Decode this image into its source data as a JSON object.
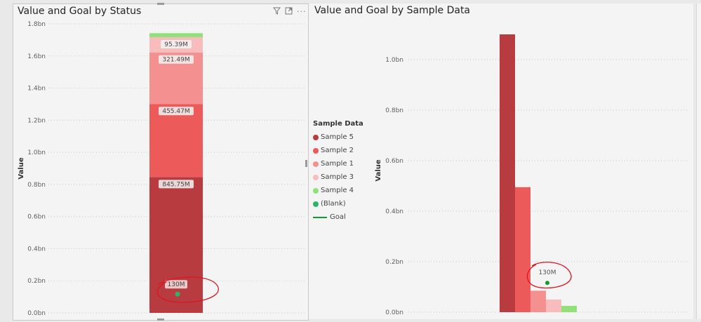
{
  "chart_data": [
    {
      "type": "bar",
      "stacked": true,
      "title": "Value and Goal by Status",
      "ylabel": "Value",
      "ylim": [
        0,
        1.8
      ],
      "yticks": [
        "0.0bn",
        "0.2bn",
        "0.4bn",
        "0.6bn",
        "0.8bn",
        "1.0bn",
        "1.2bn",
        "1.4bn",
        "1.6bn",
        "1.8bn"
      ],
      "grid": true,
      "segments": [
        {
          "name": "Sample 5",
          "value": 0.846,
          "label": "845.75M",
          "color": "#b83c3f"
        },
        {
          "name": "Sample 2",
          "value": 0.455,
          "label": "455.47M",
          "color": "#ec5a5a"
        },
        {
          "name": "Sample 1",
          "value": 0.321,
          "label": "321.49M",
          "color": "#f49090"
        },
        {
          "name": "Sample 3",
          "value": 0.095,
          "label": "95.39M",
          "color": "#f8bcbc"
        },
        {
          "name": "Sample 4",
          "value": 0.025,
          "label": "",
          "color": "#92e07a"
        }
      ],
      "goal": {
        "name": "(Blank)",
        "value": 0.13,
        "label": "130M",
        "color": "#2db36b"
      }
    },
    {
      "type": "bar",
      "title": "Value and Goal by Sample Data",
      "ylabel": "Value",
      "ylim": [
        0,
        1.15
      ],
      "yticks": [
        "0.0bn",
        "0.2bn",
        "0.4bn",
        "0.6bn",
        "0.8bn",
        "1.0bn"
      ],
      "grid": true,
      "categories": [
        "Sample 5",
        "Sample 2",
        "Sample 1",
        "Sample 3",
        "Sample 4"
      ],
      "values": [
        1.1,
        0.495,
        0.085,
        0.05,
        0.025
      ],
      "colors": [
        "#b83c3f",
        "#ec5a5a",
        "#f49090",
        "#f8bcbc",
        "#92e07a"
      ],
      "goal": {
        "value": 0.13,
        "label": "130M",
        "color": "#139b2e"
      }
    }
  ],
  "legend": {
    "title": "Sample Data",
    "position": "left",
    "items": [
      {
        "label": "Sample 5",
        "color": "#b83c3f",
        "kind": "dot"
      },
      {
        "label": "Sample 2",
        "color": "#ec5a5a",
        "kind": "dot"
      },
      {
        "label": "Sample 1",
        "color": "#f49090",
        "kind": "dot"
      },
      {
        "label": "Sample 3",
        "color": "#f8bcbc",
        "kind": "dot"
      },
      {
        "label": "Sample 4",
        "color": "#92e07a",
        "kind": "dot"
      },
      {
        "label": "(Blank)",
        "color": "#2db36b",
        "kind": "dot"
      },
      {
        "label": "Goal",
        "color": "#139b2e",
        "kind": "line"
      }
    ]
  },
  "annotation_color": "#e0141e",
  "icons": {
    "filter": "filter-icon",
    "focus": "focus-mode-icon",
    "more": "more-options-icon"
  }
}
